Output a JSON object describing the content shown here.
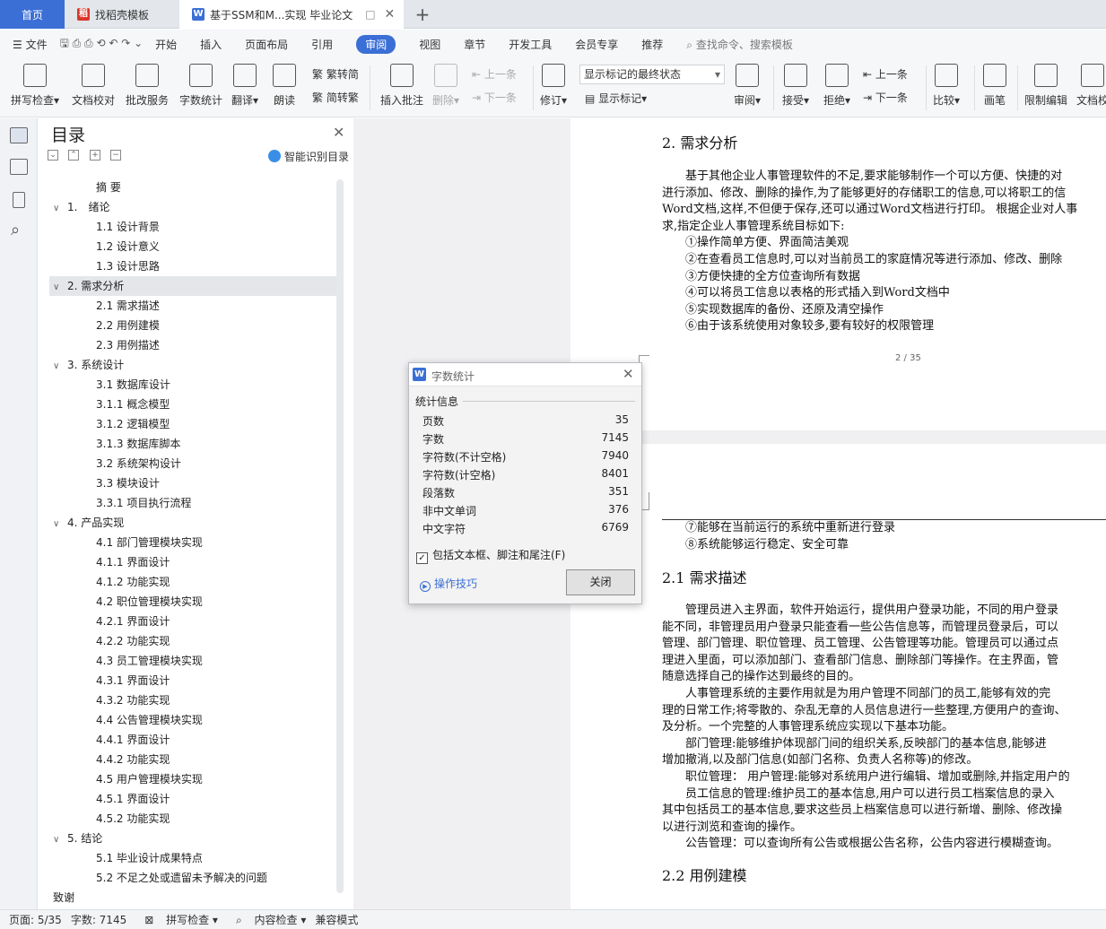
{
  "tabs": {
    "home": "首页",
    "template": "找稻壳模板",
    "document": "基于SSM和M...实现 毕业论文"
  },
  "menubar": {
    "file": "文件",
    "items": [
      "开始",
      "插入",
      "页面布局",
      "引用",
      "审阅",
      "视图",
      "章节",
      "开发工具",
      "会员专享",
      "推荐"
    ],
    "active": "审阅",
    "search_placeholder": "查找命令、搜索模板"
  },
  "ribbon": {
    "spell": "拼写检查",
    "doc_check": "文档校对",
    "batch_service": "批改服务",
    "word_count": "字数统计",
    "translate": "翻译",
    "read_aloud": "朗读",
    "trad": "繁转简",
    "simp": "简转繁",
    "insert_comment": "插入批注",
    "delete": "删除",
    "prev": "上一条",
    "next": "下一条",
    "track": "修订",
    "markup_state": "显示标记的最终状态",
    "show_markup": "显示标记",
    "review": "审阅",
    "accept": "接受",
    "reject": "拒绝",
    "prev2": "上一条",
    "next2": "下一条",
    "compare": "比较",
    "pen": "画笔",
    "restrict": "限制编辑",
    "doc_more": "文档校"
  },
  "toc": {
    "title": "目录",
    "smart": "智能识别目录",
    "items": [
      {
        "label": "摘 要",
        "level": 2,
        "arrow": ""
      },
      {
        "label": "1.　绪论",
        "level": 1,
        "arrow": "∨"
      },
      {
        "label": "1.1 设计背景",
        "level": 2,
        "arrow": ""
      },
      {
        "label": "1.2 设计意义",
        "level": 2,
        "arrow": ""
      },
      {
        "label": "1.3 设计思路",
        "level": 2,
        "arrow": ""
      },
      {
        "label": "2. 需求分析",
        "level": 1,
        "arrow": "∨"
      },
      {
        "label": "2.1 需求描述",
        "level": 2,
        "arrow": ""
      },
      {
        "label": "2.2 用例建模",
        "level": 2,
        "arrow": ""
      },
      {
        "label": "2.3 用例描述",
        "level": 2,
        "arrow": ""
      },
      {
        "label": "3. 系统设计",
        "level": 1,
        "arrow": "∨"
      },
      {
        "label": "3.1 数据库设计",
        "level": 2,
        "arrow": ""
      },
      {
        "label": "3.1.1 概念模型",
        "level": 2,
        "arrow": ""
      },
      {
        "label": "3.1.2 逻辑模型",
        "level": 2,
        "arrow": ""
      },
      {
        "label": "3.1.3 数据库脚本",
        "level": 2,
        "arrow": ""
      },
      {
        "label": "3.2 系统架构设计",
        "level": 2,
        "arrow": ""
      },
      {
        "label": "3.3 模块设计",
        "level": 2,
        "arrow": ""
      },
      {
        "label": "3.3.1 项目执行流程",
        "level": 2,
        "arrow": ""
      },
      {
        "label": "4. 产品实现",
        "level": 1,
        "arrow": "∨"
      },
      {
        "label": "4.1 部门管理模块实现",
        "level": 2,
        "arrow": ""
      },
      {
        "label": "4.1.1 界面设计",
        "level": 2,
        "arrow": ""
      },
      {
        "label": "4.1.2 功能实现",
        "level": 2,
        "arrow": ""
      },
      {
        "label": "4.2 职位管理模块实现",
        "level": 2,
        "arrow": ""
      },
      {
        "label": "4.2.1 界面设计",
        "level": 2,
        "arrow": ""
      },
      {
        "label": "4.2.2 功能实现",
        "level": 2,
        "arrow": ""
      },
      {
        "label": "4.3 员工管理模块实现",
        "level": 2,
        "arrow": ""
      },
      {
        "label": "4.3.1 界面设计",
        "level": 2,
        "arrow": ""
      },
      {
        "label": "4.3.2 功能实现",
        "level": 2,
        "arrow": ""
      },
      {
        "label": "4.4 公告管理模块实现",
        "level": 2,
        "arrow": ""
      },
      {
        "label": "4.4.1 界面设计",
        "level": 2,
        "arrow": ""
      },
      {
        "label": "4.4.2 功能实现",
        "level": 2,
        "arrow": ""
      },
      {
        "label": "4.5 用户管理模块实现",
        "level": 2,
        "arrow": ""
      },
      {
        "label": "4.5.1 界面设计",
        "level": 2,
        "arrow": ""
      },
      {
        "label": "4.5.2 功能实现",
        "level": 2,
        "arrow": ""
      },
      {
        "label": "5. 结论",
        "level": 1,
        "arrow": "∨"
      },
      {
        "label": "5.1 毕业设计成果特点",
        "level": 2,
        "arrow": ""
      },
      {
        "label": "5.2 不足之处或遗留未予解决的问题",
        "level": 2,
        "arrow": ""
      },
      {
        "label": "致谢",
        "level": 1,
        "arrow": ""
      }
    ],
    "selected_index": 5
  },
  "page1": {
    "heading": "2. 需求分析",
    "lines": [
      "　　基于其他企业人事管理软件的不足,要求能够制作一个可以方便、快捷的对",
      "进行添加、修改、删除的操作,为了能够更好的存储职工的信息,可以将职工的信",
      "Word文档,这样,不但便于保存,还可以通过Word文档进行打印。 根据企业对人事",
      "求,指定企业人事管理系统目标如下:",
      "　　①操作简单方便、界面简洁美观",
      "　　②在查看员工信息时,可以对当前员工的家庭情况等进行添加、修改、删除",
      "　　③方便快捷的全方位查询所有数据",
      "　　④可以将员工信息以表格的形式插入到Word文档中",
      "　　⑤实现数据库的备份、还原及清空操作",
      "　　⑥由于该系统使用对象较多,要有较好的权限管理"
    ],
    "page_number": "2 / 35"
  },
  "page2": {
    "lines_top": [
      "　　⑦能够在当前运行的系统中重新进行登录",
      "　　⑧系统能够运行稳定、安全可靠"
    ],
    "heading1": "2.1 需求描述",
    "lines_mid": [
      "　　管理员进入主界面，软件开始运行，提供用户登录功能，不同的用户登录",
      "能不同，非管理员用户登录只能查看一些公告信息等，而管理员登录后，可以",
      "管理、部门管理、职位管理、员工管理、公告管理等功能。管理员可以通过点",
      "理进入里面，可以添加部门、查看部门信息、删除部门等操作。在主界面，管",
      "随意选择自己的操作达到最终的目的。",
      "　　人事管理系统的主要作用就是为用户管理不同部门的员工,能够有效的完",
      "理的日常工作;将零散的、杂乱无章的人员信息进行一些整理,方便用户的查询、",
      "及分析。一个完整的人事管理系统应实现以下基本功能。",
      "　　部门管理:能够维护体现部门间的组织关系,反映部门的基本信息,能够进",
      "增加撤消,以及部门信息(如部门名称、负责人名称等)的修改。",
      "　　职位管理： 用户管理:能够对系统用户进行编辑、增加或删除,并指定用户的",
      "　　员工信息的管理:维护员工的基本信息,用户可以进行员工档案信息的录入",
      "其中包括员工的基本信息,要求这些员上档案信息可以进行新增、删除、修改操",
      "以进行浏览和查询的操作。",
      "　　公告管理：可以查询所有公告或根据公告名称，公告内容进行模糊查询。"
    ],
    "heading2": "2.2 用例建模"
  },
  "dialog": {
    "title": "字数统计",
    "section": "统计信息",
    "rows": [
      {
        "label": "页数",
        "value": "35"
      },
      {
        "label": "字数",
        "value": "7145"
      },
      {
        "label": "字符数(不计空格)",
        "value": "7940"
      },
      {
        "label": "字符数(计空格)",
        "value": "8401"
      },
      {
        "label": "段落数",
        "value": "351"
      },
      {
        "label": "非中文单词",
        "value": "376"
      },
      {
        "label": "中文字符",
        "value": "6769"
      }
    ],
    "checkbox_label": "包括文本框、脚注和尾注(F)",
    "checkbox_checked": true,
    "tips": "操作技巧",
    "close_button": "关闭"
  },
  "statusbar": {
    "page": "页面: 5/35",
    "words": "字数: 7145",
    "spell": "拼写检查",
    "content_check": "内容检查",
    "compat": "兼容模式"
  },
  "colors": {
    "accent": "#3b6fd6"
  }
}
